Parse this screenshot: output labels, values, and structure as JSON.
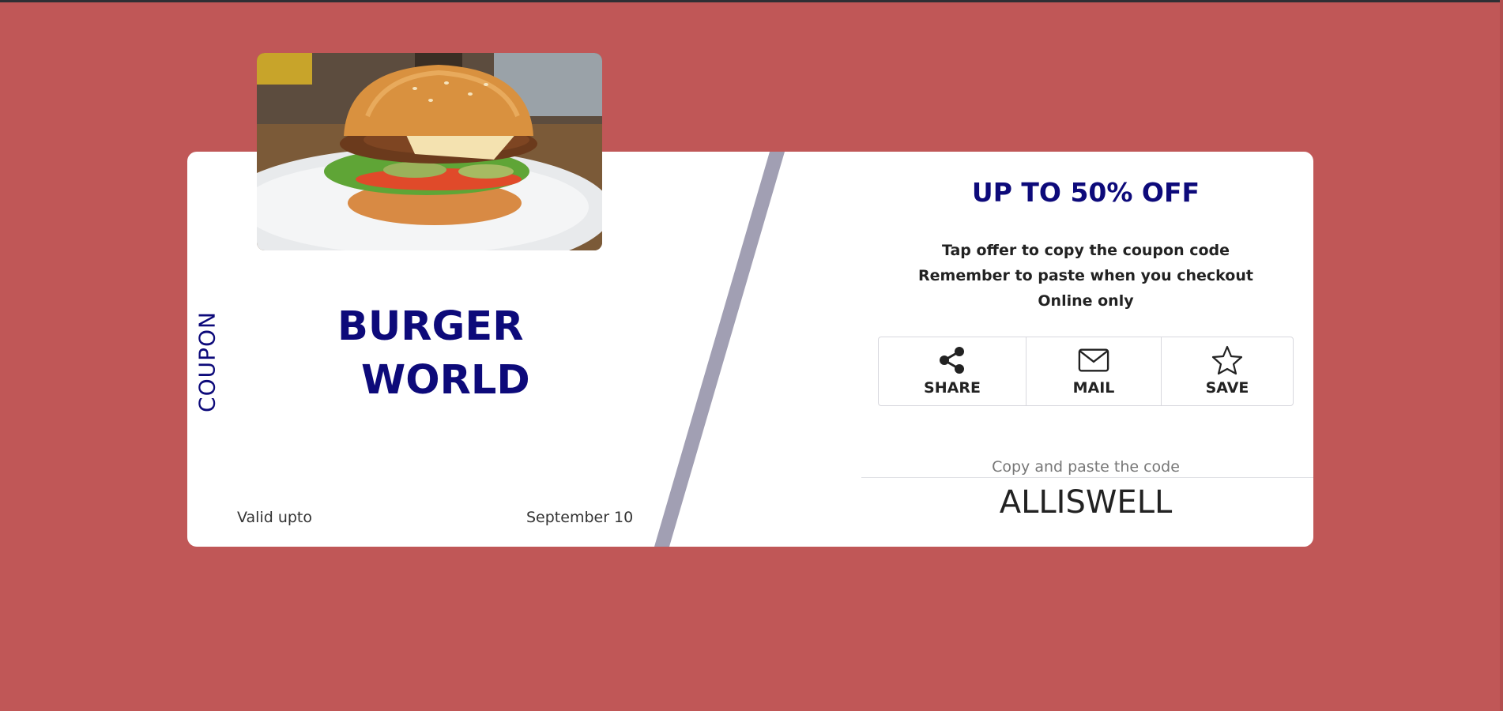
{
  "colors": {
    "page_background": "#c05757",
    "card_background": "#ffffff",
    "accent": "#0d0a7a",
    "divider": "#a19fb3"
  },
  "coupon": {
    "vertical_label": "COUPON",
    "brand_line_1": "BURGER",
    "brand_line_2": "WORLD",
    "valid_label": "Valid upto",
    "valid_date": "September 10",
    "image_icon": "burger-photo"
  },
  "offer": {
    "title": "UP TO 50% OFF",
    "instructions": [
      "Tap offer to copy the coupon code",
      "Remember to paste when you checkout",
      "Online only"
    ]
  },
  "actions": [
    {
      "label": "SHARE",
      "icon": "share-icon"
    },
    {
      "label": "MAIL",
      "icon": "mail-icon"
    },
    {
      "label": "SAVE",
      "icon": "star-icon"
    }
  ],
  "code": {
    "hint": "Copy and paste the code",
    "value": "ALLISWELL"
  }
}
